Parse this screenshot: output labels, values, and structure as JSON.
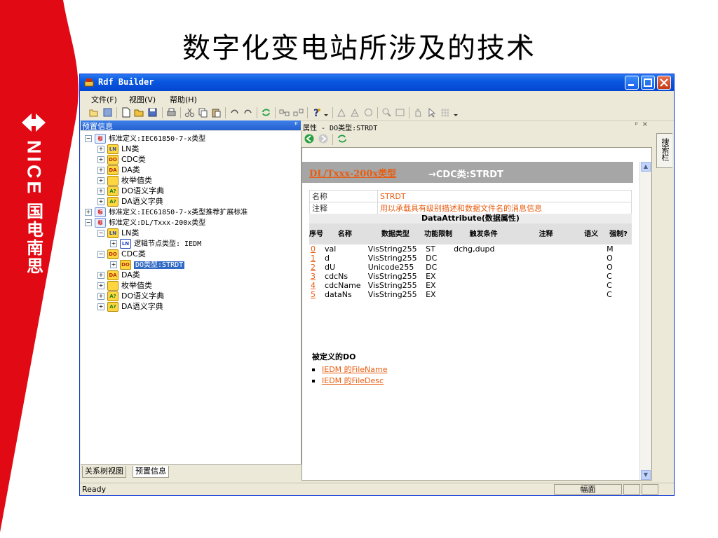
{
  "slide": {
    "title": "数字化变电站所涉及的技术",
    "brand_en": "NICE",
    "brand_cn": "国电南思",
    "band_color": "#e10a14"
  },
  "window": {
    "title": "Rdf Builder",
    "menu": [
      "文件(F)",
      "视图(V)",
      "帮助(H)"
    ],
    "toolbar_icons": [
      "new-icon",
      "save-icon",
      "new-file-icon",
      "open-icon",
      "save-disk-icon",
      "print-icon",
      "cut-icon",
      "copy-icon",
      "paste-icon",
      "undo-icon",
      "redo-icon",
      "refresh-icon",
      "connect-icon",
      "disconnect-icon",
      "help-icon",
      "dropdown-icon",
      "triangle-a-icon",
      "triangle-b-icon",
      "cycle-icon",
      "zoom-icon",
      "fit-icon",
      "hand-icon",
      "pointer-icon",
      "grid-icon",
      "dropdown-icon"
    ]
  },
  "left_panel": {
    "header": "预置信息",
    "pin": "ᵖ",
    "tree": [
      {
        "label": "标准定义:IEC61850-7-x类型",
        "mono": true,
        "icon": "std",
        "level": 0,
        "expand": "−"
      },
      {
        "label": "LN类",
        "icon": "ln",
        "level": 1,
        "expand": "+"
      },
      {
        "label": "CDC类",
        "icon": "cdc",
        "level": 1,
        "expand": "+"
      },
      {
        "label": "DA类",
        "icon": "da",
        "level": 1,
        "expand": "+"
      },
      {
        "label": "枚举值类",
        "icon": "enum",
        "level": 1,
        "expand": "+"
      },
      {
        "label": "DO语义字典",
        "icon": "dict",
        "level": 1,
        "expand": "+"
      },
      {
        "label": "DA语义字典",
        "icon": "dict",
        "level": 1,
        "expand": "+"
      },
      {
        "label": "标准定义:IEC61850-7-x类型推荐扩展标准",
        "icon": "std",
        "level": 0,
        "expand": "+"
      },
      {
        "label": "标准定义:DL/Txxx-200x类型",
        "icon": "std",
        "level": 0,
        "expand": "−"
      },
      {
        "label": "LN类",
        "icon": "ln",
        "level": 1,
        "expand": "−"
      },
      {
        "label": "逻辑节点类型: IEDM",
        "icon": "ln-blue",
        "level": 2,
        "expand": "+"
      },
      {
        "label": "CDC类",
        "icon": "cdc",
        "level": 1,
        "expand": "−"
      },
      {
        "label": "DO类型:STRDT",
        "icon": "cdc",
        "level": 2,
        "expand": "+",
        "selected": true
      },
      {
        "label": "DA类",
        "icon": "da",
        "level": 1,
        "expand": "+"
      },
      {
        "label": "枚举值类",
        "icon": "enum",
        "level": 1,
        "expand": "+"
      },
      {
        "label": "DO语义字典",
        "icon": "dict",
        "level": 1,
        "expand": "+"
      },
      {
        "label": "DA语义字典",
        "icon": "dict",
        "level": 1,
        "expand": "+"
      }
    ],
    "icon_texts": {
      "std": "标",
      "ln": "LN",
      "cdc": "DO",
      "da": "DA",
      "enum": "",
      "dict": "A?",
      "ln-blue": "LN"
    },
    "tabs": [
      "关系树视图",
      "预置信息"
    ]
  },
  "right_panel": {
    "header": "属性 - DO类型:STRDT",
    "pin": "ᵖ",
    "close": "×",
    "banner_link": "DL/Txxx-200x类型",
    "banner_rest": "→CDC类:STRDT",
    "info": [
      {
        "key": "名称",
        "value": "STRDT",
        "value_color": "#e85c10"
      },
      {
        "key": "注释",
        "value": "用以承载具有级别描述和数据文件名的消息信息",
        "value_color": "#e85c10"
      }
    ],
    "attr_title": "DataAttribute(数据属性)",
    "columns": [
      "序号",
      "名称",
      "数据类型",
      "功能限制",
      "触发条件",
      "注释",
      "语义",
      "强制?"
    ],
    "rows": [
      [
        "0",
        "val",
        "VisString255",
        "ST",
        "dchg,dupd",
        "",
        "",
        "M"
      ],
      [
        "1",
        "d",
        "VisString255",
        "DC",
        "",
        "",
        "",
        "O"
      ],
      [
        "2",
        "dU",
        "Unicode255",
        "DC",
        "",
        "",
        "",
        "O"
      ],
      [
        "3",
        "cdcNs",
        "VisString255",
        "EX",
        "",
        "",
        "",
        "C"
      ],
      [
        "4",
        "cdcName",
        "VisString255",
        "EX",
        "",
        "",
        "",
        "C"
      ],
      [
        "5",
        "dataNs",
        "VisString255",
        "EX",
        "",
        "",
        "",
        "C"
      ]
    ],
    "defined_title": "被定义的DO",
    "defined_items": [
      "IEDM 的FileName",
      "IEDM 的FileDesc"
    ]
  },
  "search_tab": "搜索栏",
  "status": {
    "ready": "Ready",
    "panel1": "幅面",
    "panel2": "",
    "panel3": ""
  }
}
